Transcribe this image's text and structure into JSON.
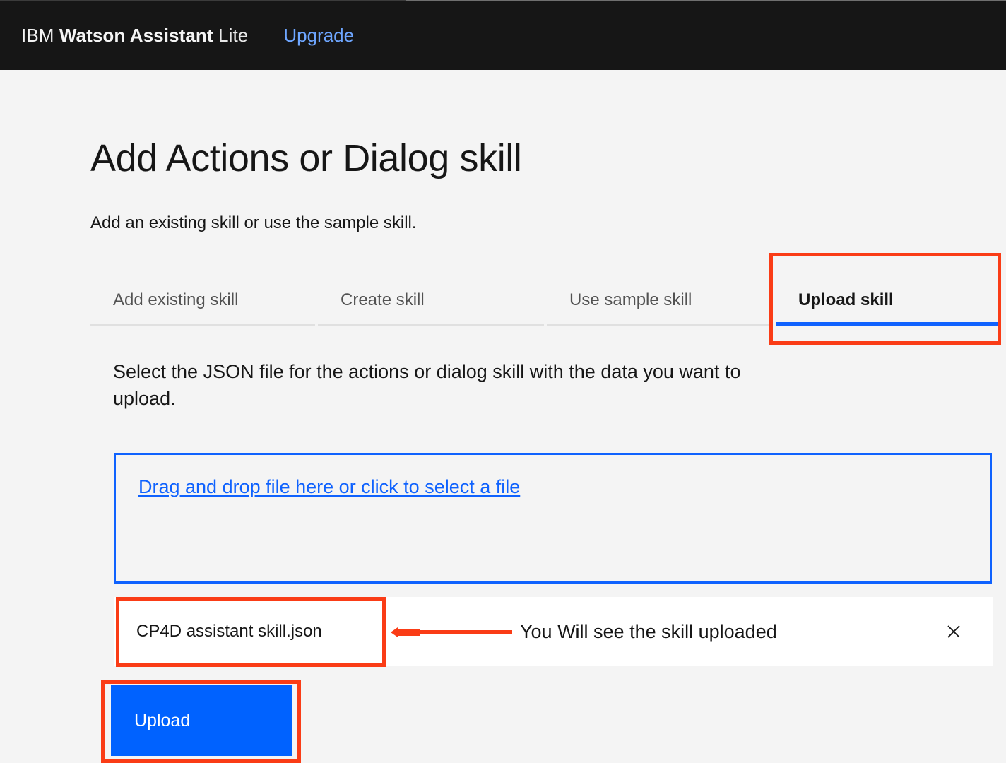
{
  "header": {
    "brand_prefix": "IBM ",
    "brand_name": "Watson Assistant",
    "brand_plan": " Lite",
    "upgrade_label": "Upgrade",
    "background": "#161616",
    "link_color": "#6ea6ff"
  },
  "page": {
    "title": "Add Actions or Dialog skill",
    "subtitle": "Add an existing skill or use the sample skill.",
    "background": "#f4f4f4"
  },
  "tabs": [
    {
      "label": "Add existing skill",
      "active": false
    },
    {
      "label": "Create skill",
      "active": false
    },
    {
      "label": "Use sample skill",
      "active": false
    },
    {
      "label": "Upload skill",
      "active": true
    }
  ],
  "panel": {
    "instructions": "Select the JSON file for the actions or dialog skill with the data you want to upload.",
    "dropzone_label": "Drag and drop file here or click to select a file",
    "dropzone_border_color": "#0f62fe",
    "file": {
      "name": "CP4D assistant skill.json",
      "close_icon": "close-icon"
    },
    "upload_button_label": "Upload",
    "upload_button_color": "#0062ff"
  },
  "annotations": {
    "color": "#fa3c16",
    "callout_text": "You Will see the skill uploaded",
    "arrow_icon": "left-arrow-icon",
    "boxes": [
      {
        "target": "upload-skill-tab"
      },
      {
        "target": "uploaded-file-name"
      },
      {
        "target": "upload-button"
      }
    ]
  }
}
